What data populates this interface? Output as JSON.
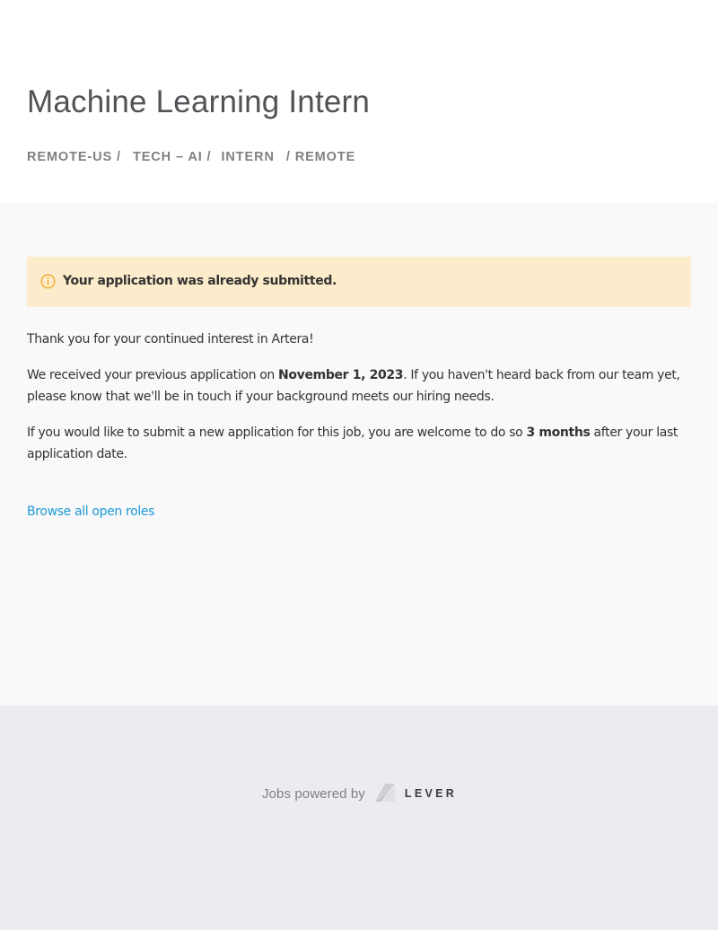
{
  "posting": {
    "title": "Machine Learning Intern",
    "categories": {
      "location": "REMOTE-US /",
      "team": "TECH – AI /",
      "commitment": "INTERN",
      "workplace": "/ REMOTE"
    }
  },
  "notice": {
    "icon": "info-circle-icon",
    "icon_color": "#f5a623",
    "background": "#fdeccb",
    "message": "Your application was already submitted."
  },
  "body": {
    "thanks": "Thank you for your continued interest in Artera!",
    "received_prefix": "We received your previous application on ",
    "received_date": "November 1, 2023",
    "received_suffix": ". If you haven't heard back from our team yet, please know that we'll be in touch if your background meets our hiring needs.",
    "reapply_prefix": "If you would like to submit a new application for this job, you are welcome to do so ",
    "reapply_period": "3 months",
    "reapply_suffix": " after your last application date.",
    "browse_link": "Browse all open roles",
    "link_color": "#1c9ad6"
  },
  "footer": {
    "powered_by": "Jobs powered by",
    "logo_icon": "lever-logo-icon",
    "brand": "LEVER"
  }
}
